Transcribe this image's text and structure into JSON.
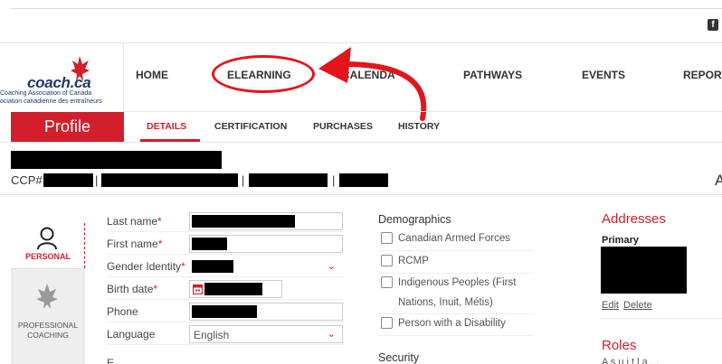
{
  "topbar": {
    "social_icon": "facebook-icon"
  },
  "logo": {
    "wordmark": "coach.ca",
    "subtitle_en": "Coaching Association of Canada",
    "subtitle_fr": "ociation canadienne des entraîneurs",
    "icon": "maple-leaf-icon"
  },
  "nav": {
    "items": [
      {
        "label": "HOME"
      },
      {
        "label": "ELEARNING"
      },
      {
        "label": "CALENDA"
      },
      {
        "label": "PATHWAYS"
      },
      {
        "label": "EVENTS"
      },
      {
        "label": "REPOR"
      }
    ]
  },
  "subnav": {
    "section_title": "Profile",
    "tabs": [
      {
        "label": "DETAILS"
      },
      {
        "label": "CERTIFICATION"
      },
      {
        "label": "PURCHASES"
      },
      {
        "label": "HISTORY"
      }
    ]
  },
  "header": {
    "ccp_label": "CCP#",
    "separator": "|",
    "right_letter": "A"
  },
  "side": {
    "personal_label": "PERSONAL",
    "coaching_label_1": "PROFESSIONAL",
    "coaching_label_2": "COACHING"
  },
  "form": {
    "last_name": "Last name",
    "first_name": "First name",
    "gender": "Gender Identity",
    "birth_date": "Birth date",
    "phone": "Phone",
    "language": "Language",
    "language_value": "English",
    "email_partial": "E",
    "required_mark": "*"
  },
  "demographics": {
    "title": "Demographics",
    "options": [
      {
        "label": "Canadian Armed Forces"
      },
      {
        "label": "RCMP"
      },
      {
        "label": "Indigenous Peoples (First"
      },
      {
        "label": "Nations, Inuit, Métis)"
      },
      {
        "label": "Person with a Disability"
      }
    ],
    "security_title": "Security"
  },
  "addresses": {
    "title": "Addresses",
    "primary": "Primary",
    "edit": "Edit",
    "delete": "Delete",
    "roles_title": "Roles",
    "roles_text": "A s  u   i    t l   a ..."
  },
  "colors": {
    "brand_red": "#d21f2b",
    "annotation_red": "#e4141b"
  }
}
